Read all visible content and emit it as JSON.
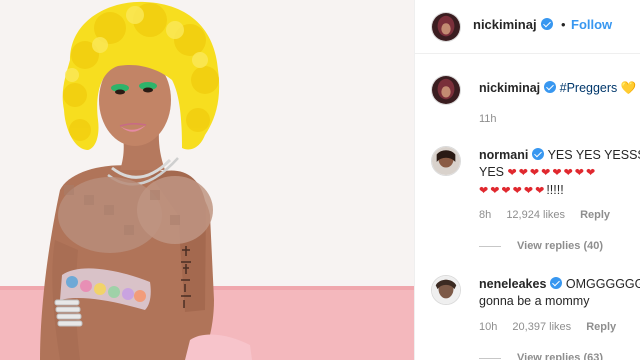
{
  "post": {
    "author": "nickiminaj",
    "follow_label": "Follow",
    "separator": "•",
    "caption_author": "nickiminaj",
    "caption_hashtag": "#Preggers",
    "caption_emoji": "💛",
    "caption_time": "11h"
  },
  "comments": [
    {
      "username": "normani",
      "text_line1": "YES YES YESSS Y",
      "text_line2_prefix": "YES",
      "hearts_line2": "❤❤❤❤❤❤❤❤",
      "hearts_line3": "❤❤❤❤❤❤",
      "suffix_line3": "!!!!!",
      "time": "8h",
      "likes": "12,924 likes",
      "reply_label": "Reply",
      "view_replies": "View replies (40)"
    },
    {
      "username": "neneleakes",
      "text_line1": "OMGGGGGG!",
      "text_line2": "gonna be a mommy",
      "time": "10h",
      "likes": "20,397 likes",
      "reply_label": "Reply",
      "view_replies": "View replies (63)"
    }
  ],
  "colors": {
    "accent": "#3897f0",
    "wig": "#f7de1f",
    "background_pink": "#f4b8bd",
    "heart": "#e0282e"
  },
  "icons": [
    "verified-badge-icon",
    "heart-emoji-icon",
    "yellow-heart-icon"
  ]
}
